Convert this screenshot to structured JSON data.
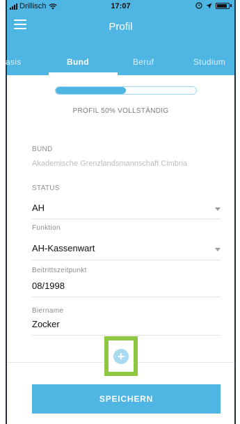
{
  "status_bar": {
    "carrier": "Drillisch",
    "time": "17:07"
  },
  "header": {
    "title": "Profil"
  },
  "tabs": [
    {
      "label": "asis"
    },
    {
      "label": "Bund"
    },
    {
      "label": "Beruf"
    },
    {
      "label": "Studium"
    }
  ],
  "progress": {
    "percent": 50,
    "label": "PROFIL 50% VOLLSTÄNDIG"
  },
  "form": {
    "bund": {
      "label": "BUND",
      "value": "Akademische Grenzlandsmannschaft Cimbria"
    },
    "status": {
      "label": "STATUS",
      "value": "AH"
    },
    "funktion": {
      "label": "Funktion",
      "value": "AH-Kassenwart"
    },
    "beitritt": {
      "label": "Beitrittszeitpunkt",
      "value": "08/1998"
    },
    "biername": {
      "label": "Biername",
      "value": "Zocker"
    }
  },
  "add_button": {
    "icon": "plus-icon",
    "glyph": "+"
  },
  "save_button": {
    "label": "SPEICHERN"
  },
  "colors": {
    "accent": "#4fb6e3",
    "highlight": "#8dc63f"
  }
}
